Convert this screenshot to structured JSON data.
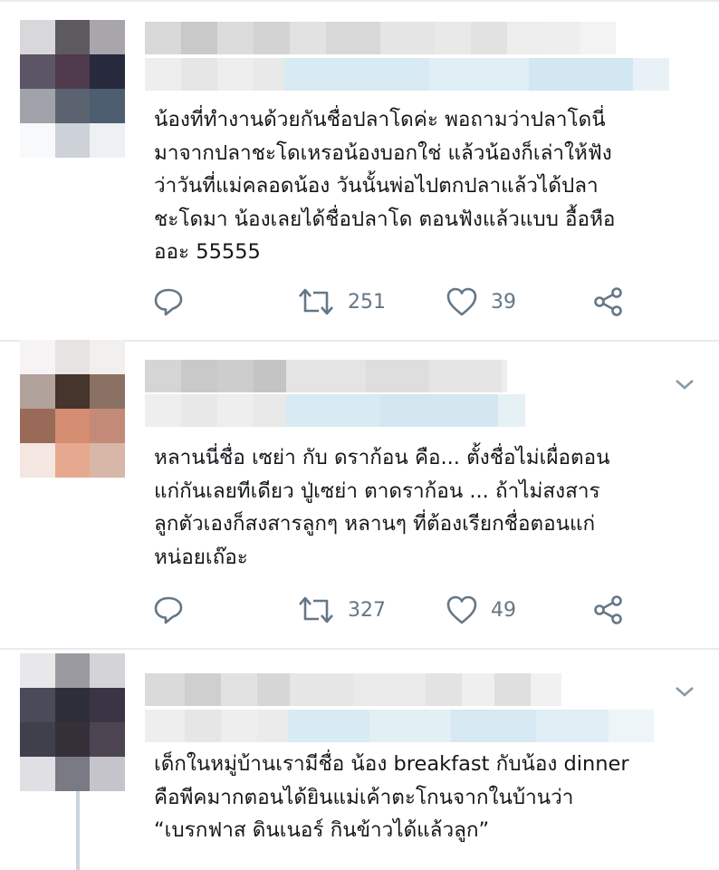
{
  "tweets": [
    {
      "text": "น้องที่ทำงานด้วยกันชื่อปลาโดค่ะ พอถามว่าปลาโดนี่\nมาจากปลาชะโดเหรอน้องบอกใช่ แล้วน้องก็เล่าให้ฟัง\nว่าวันที่แม่คลอดน้อง วันนั้นพ่อไปตกปลาแล้วได้ปลา\nชะโดมา น้องเลยได้ชื่อปลาโด ตอนฟังแล้วแบบ อื้อหือ\nออะ 55555",
      "retweets": "251",
      "likes": "39"
    },
    {
      "text": "หลานนี่ชื่อ เซย่า กับ ดราก้อน คือ... ตั้งชื่อไม่เผื่อตอน\nแก่กันเลยทีเดียว ปู่เซย่า ตาดราก้อน ... ถ้าไม่สงสาร\nลูกตัวเองก็สงสารลูกๆ หลานๆ ที่ต้องเรียกชื่อตอนแก่\nหน่อยเถ๊อะ",
      "retweets": "327",
      "likes": "49"
    },
    {
      "text": "เด็กในหมู่บ้านเรามีชื่อ น้อง breakfast กับน้อง dinner\nคือพีคมากตอนได้ยินแม่เค้าตะโกนจากในบ้านว่า\n“เบรกฟาส ดินเนอร์ กินข้าวได้แล้วลูก”"
    }
  ],
  "colors": {
    "icon": "#657786",
    "divider": "#e6ecf0",
    "text": "#14171a"
  },
  "icons": [
    "reply-icon",
    "retweet-icon",
    "like-icon",
    "share-icon",
    "chevron-down-icon"
  ]
}
